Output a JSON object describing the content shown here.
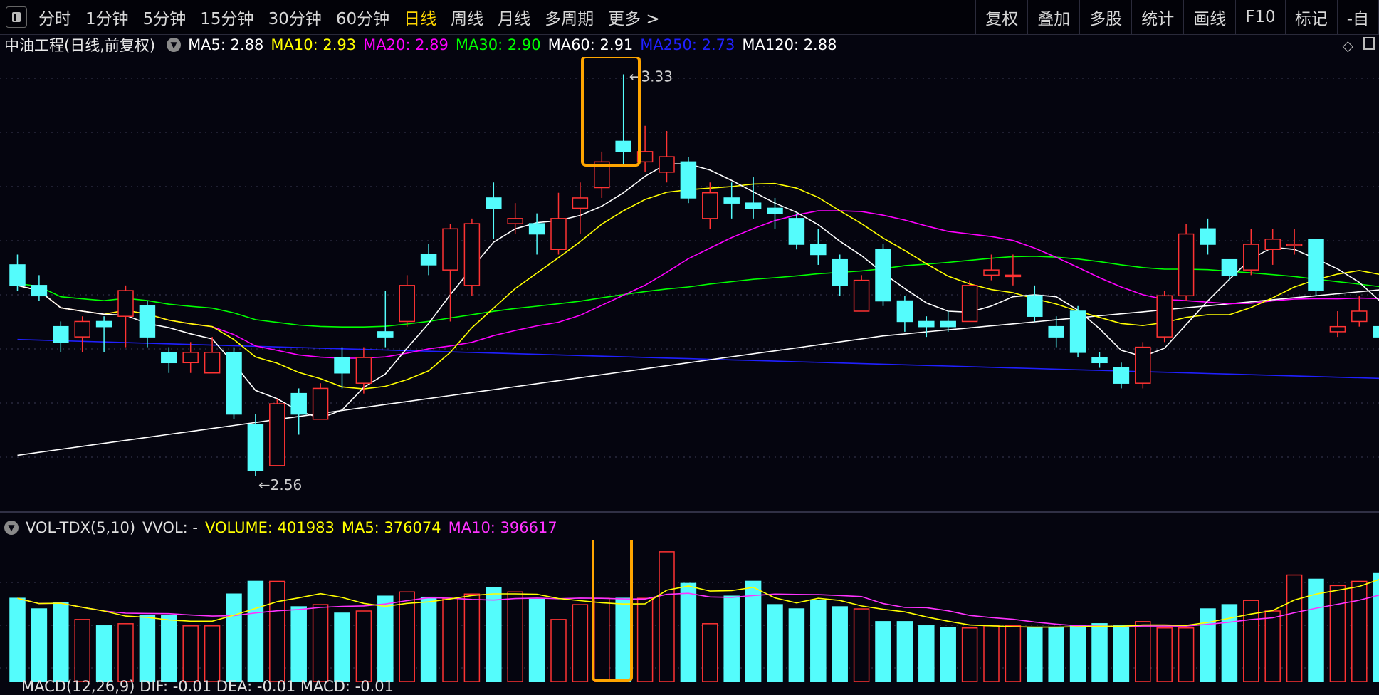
{
  "toolbar": {
    "tabs": [
      {
        "label": "分时",
        "active": false
      },
      {
        "label": "1分钟",
        "active": false
      },
      {
        "label": "5分钟",
        "active": false
      },
      {
        "label": "15分钟",
        "active": false
      },
      {
        "label": "30分钟",
        "active": false
      },
      {
        "label": "60分钟",
        "active": false
      },
      {
        "label": "日线",
        "active": true
      },
      {
        "label": "周线",
        "active": false
      },
      {
        "label": "月线",
        "active": false
      },
      {
        "label": "多周期",
        "active": false
      },
      {
        "label": "更多 >",
        "active": false
      }
    ],
    "tools": [
      "复权",
      "叠加",
      "多股",
      "统计",
      "画线",
      "F10",
      "标记",
      "-自"
    ]
  },
  "kline": {
    "title": "中油工程(日线,前复权)",
    "mas": [
      {
        "label": "MA5: 2.88",
        "color": "#ffffff"
      },
      {
        "label": "MA10: 2.93",
        "color": "#ffff00"
      },
      {
        "label": "MA20: 2.89",
        "color": "#ff00ff"
      },
      {
        "label": "MA30: 2.90",
        "color": "#00ff00"
      },
      {
        "label": "MA60: 2.91",
        "color": "#ffffff"
      },
      {
        "label": "MA250: 2.73",
        "color": "#2020ff"
      },
      {
        "label": "MA120: 2.88",
        "color": "#ffffff"
      }
    ],
    "high_label": "3.33",
    "low_label": "2.56",
    "candles": [
      [
        2.96,
        2.92,
        2.98,
        2.91
      ],
      [
        2.92,
        2.9,
        2.94,
        2.89
      ],
      [
        2.84,
        2.81,
        2.85,
        2.79
      ],
      [
        2.82,
        2.85,
        2.86,
        2.79
      ],
      [
        2.85,
        2.84,
        2.86,
        2.79
      ],
      [
        2.86,
        2.91,
        2.92,
        2.8
      ],
      [
        2.88,
        2.82,
        2.89,
        2.8
      ],
      [
        2.79,
        2.77,
        2.8,
        2.75
      ],
      [
        2.77,
        2.79,
        2.81,
        2.75
      ],
      [
        2.75,
        2.79,
        2.82,
        2.75
      ],
      [
        2.79,
        2.67,
        2.8,
        2.66
      ],
      [
        2.65,
        2.56,
        2.67,
        2.55
      ],
      [
        2.57,
        2.69,
        2.7,
        2.57
      ],
      [
        2.71,
        2.67,
        2.72,
        2.63
      ],
      [
        2.66,
        2.72,
        2.73,
        2.66
      ],
      [
        2.78,
        2.75,
        2.8,
        2.72
      ],
      [
        2.73,
        2.78,
        2.8,
        2.71
      ],
      [
        2.83,
        2.82,
        2.91,
        2.8
      ],
      [
        2.85,
        2.92,
        2.94,
        2.84
      ],
      [
        2.98,
        2.96,
        3.0,
        2.94
      ],
      [
        2.95,
        3.03,
        3.04,
        2.85
      ],
      [
        2.92,
        3.04,
        3.05,
        2.9
      ],
      [
        3.09,
        3.07,
        3.12,
        3.01
      ],
      [
        3.04,
        3.05,
        3.08,
        3.02
      ],
      [
        3.04,
        3.02,
        3.06,
        2.98
      ],
      [
        2.99,
        3.05,
        3.1,
        2.98
      ],
      [
        3.07,
        3.09,
        3.12,
        3.02
      ],
      [
        3.11,
        3.16,
        3.18,
        3.09
      ],
      [
        3.2,
        3.18,
        3.33,
        3.15
      ],
      [
        3.16,
        3.18,
        3.23,
        3.14
      ],
      [
        3.14,
        3.17,
        3.22,
        3.12
      ],
      [
        3.16,
        3.09,
        3.17,
        3.08
      ],
      [
        3.05,
        3.1,
        3.12,
        3.03
      ],
      [
        3.09,
        3.08,
        3.12,
        3.05
      ],
      [
        3.08,
        3.07,
        3.13,
        3.05
      ],
      [
        3.07,
        3.06,
        3.09,
        3.03
      ],
      [
        3.05,
        3.0,
        3.06,
        2.99
      ],
      [
        3.0,
        2.98,
        3.03,
        2.96
      ],
      [
        2.97,
        2.92,
        2.98,
        2.9
      ],
      [
        2.87,
        2.93,
        2.94,
        2.87
      ],
      [
        2.99,
        2.89,
        3.0,
        2.88
      ],
      [
        2.89,
        2.85,
        2.9,
        2.83
      ],
      [
        2.85,
        2.84,
        2.86,
        2.82
      ],
      [
        2.85,
        2.84,
        2.87,
        2.83
      ],
      [
        2.85,
        2.92,
        2.93,
        2.85
      ],
      [
        2.94,
        2.95,
        2.98,
        2.93
      ],
      [
        2.94,
        2.94,
        2.98,
        2.92
      ],
      [
        2.9,
        2.86,
        2.92,
        2.85
      ],
      [
        2.84,
        2.82,
        2.86,
        2.8
      ],
      [
        2.87,
        2.79,
        2.88,
        2.78
      ],
      [
        2.78,
        2.77,
        2.79,
        2.76
      ],
      [
        2.76,
        2.73,
        2.77,
        2.72
      ],
      [
        2.73,
        2.8,
        2.81,
        2.72
      ],
      [
        2.82,
        2.9,
        2.91,
        2.81
      ],
      [
        2.9,
        3.02,
        3.04,
        2.89
      ],
      [
        3.03,
        3.0,
        3.05,
        2.98
      ],
      [
        2.97,
        2.94,
        2.97,
        2.93
      ],
      [
        2.95,
        3.0,
        3.03,
        2.94
      ],
      [
        2.99,
        3.01,
        3.03,
        2.96
      ],
      [
        3.0,
        3.0,
        3.03,
        2.98
      ],
      [
        3.01,
        2.91,
        3.01,
        2.9
      ],
      [
        2.83,
        2.84,
        2.87,
        2.82
      ],
      [
        2.85,
        2.87,
        2.9,
        2.84
      ],
      [
        2.84,
        2.82,
        2.87,
        2.81
      ]
    ]
  },
  "volume": {
    "indicator": "VOL-TDX(5,10)",
    "vvol": "VVOL: -",
    "volume_label": "VOLUME: 401983",
    "ma5_label": "MA5: 376074",
    "ma10_label": "MA10: 396617",
    "bars": [
      380,
      330,
      360,
      280,
      250,
      260,
      300,
      300,
      250,
      250,
      400,
      460,
      460,
      340,
      350,
      310,
      320,
      390,
      410,
      385,
      380,
      400,
      430,
      410,
      375,
      280,
      350,
      380,
      380,
      380,
      600,
      450,
      260,
      390,
      460,
      350,
      330,
      370,
      340,
      330,
      270,
      270,
      250,
      240,
      240,
      250,
      250,
      240,
      240,
      250,
      260,
      250,
      270,
      240,
      240,
      330,
      350,
      370,
      320,
      490,
      470,
      440,
      460,
      500
    ]
  },
  "macd_label": "MACD(12,26,9) DIF: -0.01 DEA: -0.01 MACD: -0.01",
  "colors": {
    "up": "#ff3333",
    "down": "#54fcfc",
    "ma5": "#ffffff",
    "ma10": "#ffff00",
    "ma20": "#ff00ff",
    "ma30": "#00ff00",
    "ma60": "#d8d8d8",
    "ma120": "#ffffff",
    "ma250": "#2020ff",
    "highlight": "#ffa500",
    "grid": "#3a3a55"
  }
}
